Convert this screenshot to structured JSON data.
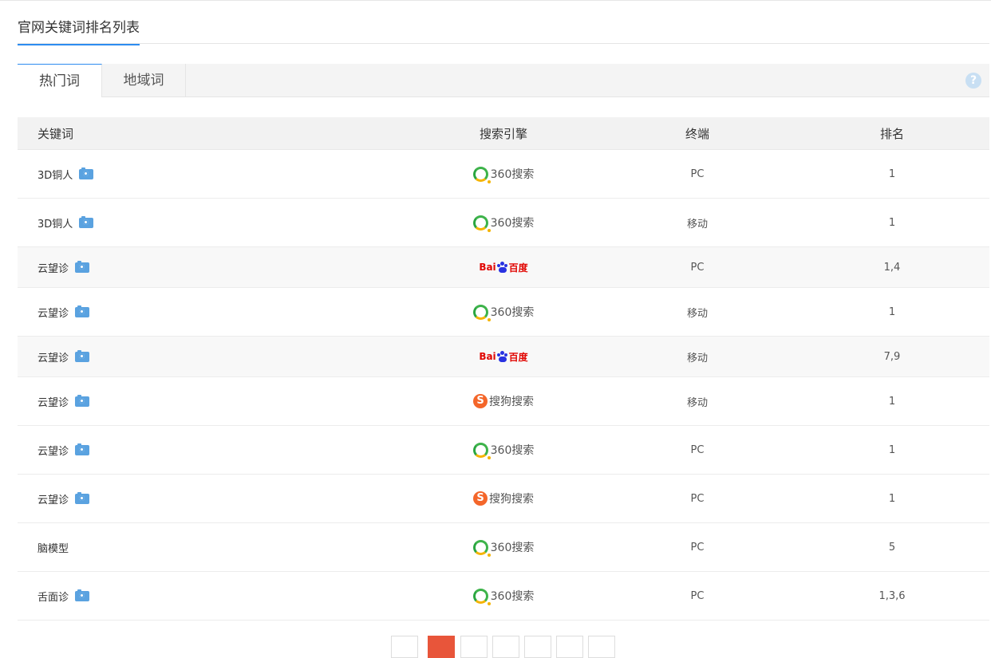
{
  "section": {
    "title": "官网关键词排名列表"
  },
  "tabs": [
    {
      "label": "热门词",
      "active": true
    },
    {
      "label": "地域词",
      "active": false
    }
  ],
  "help": {
    "icon": "help-icon",
    "symbol": "?"
  },
  "table": {
    "headers": {
      "keyword": "关键词",
      "engine": "搜索引擎",
      "terminal": "终端",
      "rank": "排名"
    },
    "rows": [
      {
        "keyword": "3D铜人",
        "snapshot": true,
        "engine": "360",
        "engine_label": "360搜索",
        "terminal": "PC",
        "rank": "1"
      },
      {
        "keyword": "3D铜人",
        "snapshot": true,
        "engine": "360",
        "engine_label": "360搜索",
        "terminal": "移动",
        "rank": "1"
      },
      {
        "keyword": "云望诊",
        "snapshot": true,
        "engine": "baidu",
        "engine_label": "百度",
        "terminal": "PC",
        "rank": "1,4"
      },
      {
        "keyword": "云望诊",
        "snapshot": true,
        "engine": "360",
        "engine_label": "360搜索",
        "terminal": "移动",
        "rank": "1"
      },
      {
        "keyword": "云望诊",
        "snapshot": true,
        "engine": "baidu",
        "engine_label": "百度",
        "terminal": "移动",
        "rank": "7,9"
      },
      {
        "keyword": "云望诊",
        "snapshot": true,
        "engine": "sogou",
        "engine_label": "搜狗搜索",
        "terminal": "移动",
        "rank": "1"
      },
      {
        "keyword": "云望诊",
        "snapshot": true,
        "engine": "360",
        "engine_label": "360搜索",
        "terminal": "PC",
        "rank": "1"
      },
      {
        "keyword": "云望诊",
        "snapshot": true,
        "engine": "sogou",
        "engine_label": "搜狗搜索",
        "terminal": "PC",
        "rank": "1"
      },
      {
        "keyword": "脑模型",
        "snapshot": false,
        "engine": "360",
        "engine_label": "360搜索",
        "terminal": "PC",
        "rank": "5"
      },
      {
        "keyword": "舌面诊",
        "snapshot": true,
        "engine": "360",
        "engine_label": "360搜索",
        "terminal": "PC",
        "rank": "1,3,6"
      }
    ]
  },
  "logos": {
    "baidu_text_left": "Bai",
    "baidu_text_paw": "du",
    "baidu_text_right": "百度",
    "sogou_mark": "S"
  },
  "colors": {
    "accent": "#2d8cf0",
    "pager_active": "#e8553a",
    "snapshot_icon": "#5aa2e0"
  },
  "pager": {
    "count": 7,
    "active_index": 1
  }
}
